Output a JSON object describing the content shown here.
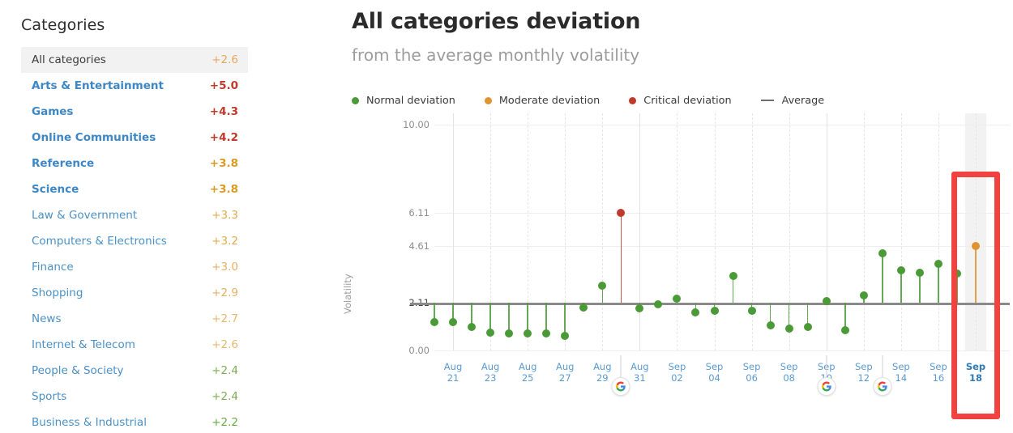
{
  "sidebar": {
    "title": "Categories",
    "items": [
      {
        "label": "All categories",
        "value": "+2.6",
        "color": "#e8a75c",
        "bold": false,
        "active": true
      },
      {
        "label": "Arts & Entertainment",
        "value": "+5.0",
        "color": "#c0392b",
        "bold": true,
        "active": false
      },
      {
        "label": "Games",
        "value": "+4.3",
        "color": "#c0392b",
        "bold": true,
        "active": false
      },
      {
        "label": "Online Communities",
        "value": "+4.2",
        "color": "#c0392b",
        "bold": true,
        "active": false
      },
      {
        "label": "Reference",
        "value": "+3.8",
        "color": "#d99a22",
        "bold": true,
        "active": false
      },
      {
        "label": "Science",
        "value": "+3.8",
        "color": "#d99a22",
        "bold": true,
        "active": false
      },
      {
        "label": "Law & Government",
        "value": "+3.3",
        "color": "#e0a94e",
        "bold": false,
        "active": false
      },
      {
        "label": "Computers & Electronics",
        "value": "+3.2",
        "color": "#e0a94e",
        "bold": false,
        "active": false
      },
      {
        "label": "Finance",
        "value": "+3.0",
        "color": "#e3b160",
        "bold": false,
        "active": false
      },
      {
        "label": "Shopping",
        "value": "+2.9",
        "color": "#e3b160",
        "bold": false,
        "active": false
      },
      {
        "label": "News",
        "value": "+2.7",
        "color": "#e6b86e",
        "bold": false,
        "active": false
      },
      {
        "label": "Internet & Telecom",
        "value": "+2.6",
        "color": "#e6b86e",
        "bold": false,
        "active": false
      },
      {
        "label": "People & Society",
        "value": "+2.4",
        "color": "#7cab53",
        "bold": false,
        "active": false
      },
      {
        "label": "Sports",
        "value": "+2.4",
        "color": "#7cab53",
        "bold": false,
        "active": false
      },
      {
        "label": "Business & Industrial",
        "value": "+2.2",
        "color": "#6aa845",
        "bold": false,
        "active": false
      }
    ]
  },
  "chart_header": {
    "title": "All categories deviation",
    "subtitle": "from the average monthly volatility"
  },
  "legend": [
    {
      "label": "Normal deviation",
      "color": "#4a9a37",
      "marker": "dot"
    },
    {
      "label": "Moderate deviation",
      "color": "#e0932e",
      "marker": "dot"
    },
    {
      "label": "Critical deviation",
      "color": "#c0392b",
      "marker": "dot"
    },
    {
      "label": "Average",
      "color": "#6e6e6e",
      "marker": "dash"
    }
  ],
  "chart_data": {
    "type": "scatter",
    "title": "All categories deviation",
    "subtitle": "from the average monthly volatility",
    "xlabel": "",
    "ylabel": "Volatility",
    "ylim": [
      0,
      10
    ],
    "yticks": [
      "0.00",
      "2.11",
      "4.61",
      "6.11",
      "10.00"
    ],
    "ytick_values": [
      0,
      2.11,
      4.61,
      6.11,
      10
    ],
    "baseline": 2.11,
    "baseline_label": "Average",
    "grid": true,
    "legend_position": "top-left",
    "highlighted_x": "Sep 18",
    "x": [
      "Aug 20",
      "Aug 21",
      "Aug 22",
      "Aug 23",
      "Aug 24",
      "Aug 25",
      "Aug 26",
      "Aug 27",
      "Aug 28",
      "Aug 29",
      "Aug 30",
      "Aug 31",
      "Sep 01",
      "Sep 02",
      "Sep 03",
      "Sep 04",
      "Sep 05",
      "Sep 06",
      "Sep 07",
      "Sep 08",
      "Sep 09",
      "Sep 10",
      "Sep 11",
      "Sep 12",
      "Sep 13",
      "Sep 14",
      "Sep 15",
      "Sep 16",
      "Sep 17",
      "Sep 18"
    ],
    "xticks": [
      {
        "month": "Aug",
        "day": "21",
        "index": 1
      },
      {
        "month": "Aug",
        "day": "23",
        "index": 3
      },
      {
        "month": "Aug",
        "day": "25",
        "index": 5
      },
      {
        "month": "Aug",
        "day": "27",
        "index": 7
      },
      {
        "month": "Aug",
        "day": "29",
        "index": 9
      },
      {
        "month": "Aug",
        "day": "31",
        "index": 11
      },
      {
        "month": "Sep",
        "day": "02",
        "index": 13
      },
      {
        "month": "Sep",
        "day": "04",
        "index": 15
      },
      {
        "month": "Sep",
        "day": "06",
        "index": 17
      },
      {
        "month": "Sep",
        "day": "08",
        "index": 19
      },
      {
        "month": "Sep",
        "day": "10",
        "index": 21
      },
      {
        "month": "Sep",
        "day": "12",
        "index": 23
      },
      {
        "month": "Sep",
        "day": "14",
        "index": 25
      },
      {
        "month": "Sep",
        "day": "16",
        "index": 27
      },
      {
        "month": "Sep",
        "day": "18",
        "index": 29
      }
    ],
    "values": [
      1.25,
      1.25,
      1.05,
      0.8,
      0.75,
      0.75,
      0.75,
      0.65,
      1.9,
      2.85,
      6.11,
      1.85,
      2.05,
      2.3,
      1.7,
      1.75,
      3.3,
      1.75,
      1.1,
      0.95,
      1.05,
      2.2,
      0.9,
      2.45,
      4.3,
      3.55,
      3.45,
      3.85,
      3.4,
      4.61
    ],
    "statuses": [
      "normal",
      "normal",
      "normal",
      "normal",
      "normal",
      "normal",
      "normal",
      "normal",
      "normal",
      "normal",
      "critical",
      "normal",
      "normal",
      "normal",
      "normal",
      "normal",
      "normal",
      "normal",
      "normal",
      "normal",
      "normal",
      "normal",
      "normal",
      "normal",
      "normal",
      "normal",
      "normal",
      "normal",
      "normal",
      "moderate"
    ],
    "colors": {
      "normal": "#4a9a37",
      "moderate": "#e0932e",
      "critical": "#c0392b",
      "average": "#8a8a8a"
    },
    "google_updates": [
      {
        "label": "google-update",
        "index": 10
      },
      {
        "label": "google-update",
        "index": 21
      },
      {
        "label": "google-update",
        "index": 24
      }
    ]
  }
}
